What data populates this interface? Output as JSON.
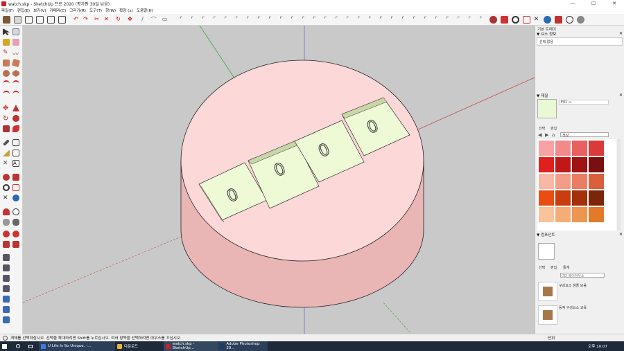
{
  "window": {
    "title": "watch.skp - SketchUp 프로 2020 (평가판 30일 남음)",
    "minimize_glyph": "—",
    "maximize_glyph": "☐",
    "close_glyph": "✕"
  },
  "menu": [
    "파일(F)",
    "편집(E)",
    "보기(V)",
    "카메라(C)",
    "그리기(R)",
    "도구(T)",
    "창(W)",
    "확장 (x)",
    "도움말(H)"
  ],
  "tray": {
    "title": "기본 트레이",
    "entity_info": {
      "header": "요소 정보",
      "text": "선택 없음"
    },
    "materials": {
      "header": "재질",
      "material_name": "F01 ↔",
      "tab_select": "선택",
      "tab_edit": "편집",
      "category": "색상",
      "preview_color": "#e8f9d4",
      "swatch_colors": [
        "#f7a3a3",
        "#f28a8a",
        "#e86060",
        "#d93a3a",
        "#e0201c",
        "#c01818",
        "#a01313",
        "#7a0f0f",
        "#f9b7a5",
        "#f39c86",
        "#e97e62",
        "#d9603d",
        "#ea4d12",
        "#c93d0f",
        "#a3310c",
        "#7b260a",
        "#f9c39b",
        "#f5ad78",
        "#ee9550",
        "#e27a2a",
        "#e98418",
        "#c96d10",
        "#a6590d",
        "#834509"
      ]
    },
    "components": {
      "header": "컴포넌트",
      "tab_select": "선택",
      "tab_edit": "편집",
      "tab_stats": "통계",
      "search_placeholder": "3D 웨어하우스",
      "items": [
        "구성요소 샘플 모음",
        "동적 구성요소 교육"
      ]
    }
  },
  "status": {
    "text": "개체를 선택하십시오. 선택을 확대하려면 Shift를 누르십시오. 여러 항목을 선택하려면 마우스를 끄십시오.",
    "measurement_label": "단위"
  },
  "taskbar": {
    "tasks": [
      "U Life Is So Unique, -...",
      "다운로드",
      "watch.skp - SketchUp...",
      "Adobe Photoshop 20..."
    ],
    "clock": "오후 10:07"
  },
  "scene": {
    "digits": [
      "0",
      "0",
      "0",
      "0"
    ],
    "cylinder_top": "#fdd8d8",
    "cylinder_side": "#e9b5b5",
    "block_face": "#eef9d6",
    "block_top": "#c8d6a8"
  }
}
